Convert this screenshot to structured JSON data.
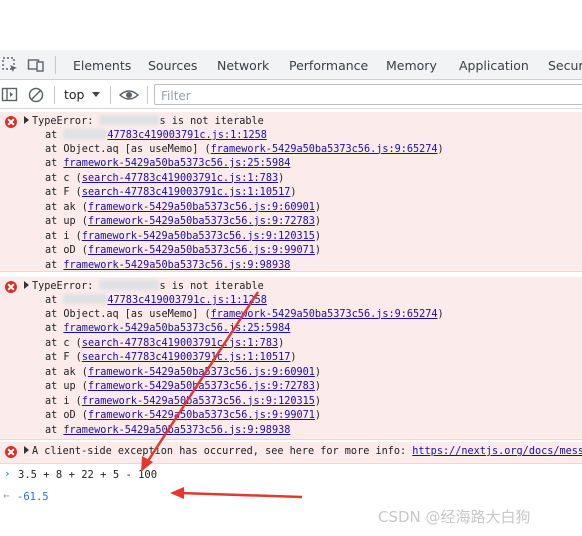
{
  "devtools": {
    "tabs": [
      "Elements",
      "Sources",
      "Network",
      "Performance",
      "Memory",
      "Application",
      "Securi"
    ],
    "toolbar": {
      "context": "top",
      "filter_placeholder": "Filter"
    }
  },
  "console": {
    "errors": [
      {
        "head_prefix": "TypeError: ",
        "head_suffix": "s is not iterable",
        "frames": [
          {
            "at": "at ",
            "name": "",
            "link": "47783c419003791c.js:1:1258",
            "paren": false
          },
          {
            "at": "at ",
            "name": "Object.aq [as useMemo] (",
            "link": "framework-5429a50ba5373c56.js:9:65274",
            "paren": true
          },
          {
            "at": "at ",
            "name": "",
            "link": "framework-5429a50ba5373c56.js:25:5984",
            "paren": false
          },
          {
            "at": "at ",
            "name": "c (",
            "link": "search-47783c419003791c.js:1:783",
            "paren": true
          },
          {
            "at": "at ",
            "name": "F (",
            "link": "search-47783c419003791c.js:1:10517",
            "paren": true
          },
          {
            "at": "at ",
            "name": "ak (",
            "link": "framework-5429a50ba5373c56.js:9:60901",
            "paren": true
          },
          {
            "at": "at ",
            "name": "up (",
            "link": "framework-5429a50ba5373c56.js:9:72783",
            "paren": true
          },
          {
            "at": "at ",
            "name": "i (",
            "link": "framework-5429a50ba5373c56.js:9:120315",
            "paren": true
          },
          {
            "at": "at ",
            "name": "oD (",
            "link": "framework-5429a50ba5373c56.js:9:99071",
            "paren": true
          },
          {
            "at": "at ",
            "name": "",
            "link": "framework-5429a50ba5373c56.js:9:98938",
            "paren": false
          }
        ]
      },
      {
        "head_prefix": "TypeError: ",
        "head_suffix": "s is not iterable",
        "frames": [
          {
            "at": "at ",
            "name": "",
            "link": "47783c419003791c.js:1:1258",
            "paren": false
          },
          {
            "at": "at ",
            "name": "Object.aq [as useMemo] (",
            "link": "framework-5429a50ba5373c56.js:9:65274",
            "paren": true
          },
          {
            "at": "at ",
            "name": "",
            "link": "framework-5429a50ba5373c56.js:25:5984",
            "paren": false
          },
          {
            "at": "at ",
            "name": "c (",
            "link": "search-47783c419003791c.js:1:783",
            "paren": true
          },
          {
            "at": "at ",
            "name": "F (",
            "link": "search-47783c419003791c.js:1:10517",
            "paren": true
          },
          {
            "at": "at ",
            "name": "ak (",
            "link": "framework-5429a50ba5373c56.js:9:60901",
            "paren": true
          },
          {
            "at": "at ",
            "name": "up (",
            "link": "framework-5429a50ba5373c56.js:9:72783",
            "paren": true
          },
          {
            "at": "at ",
            "name": "i (",
            "link": "framework-5429a50ba5373c56.js:9:120315",
            "paren": true
          },
          {
            "at": "at ",
            "name": "oD (",
            "link": "framework-5429a50ba5373c56.js:9:99071",
            "paren": true
          },
          {
            "at": "at ",
            "name": "",
            "link": "framework-5429a50ba5373c56.js:9:98938",
            "paren": false
          }
        ]
      }
    ],
    "message": {
      "text": "A client-side exception has occurred, see here for more info: ",
      "link": "https://nextjs.org/docs/messag"
    },
    "input": "3.5 + 8 + 22 + 5 - 100",
    "result": "-61.5"
  },
  "watermark": "CSDN @经海路大白狗",
  "colors": {
    "error_bg": "#fcebeb",
    "error_icon": "#d93025",
    "link": "#1a0dab",
    "result": "#1a73e8",
    "arrow": "#e03a2f"
  }
}
